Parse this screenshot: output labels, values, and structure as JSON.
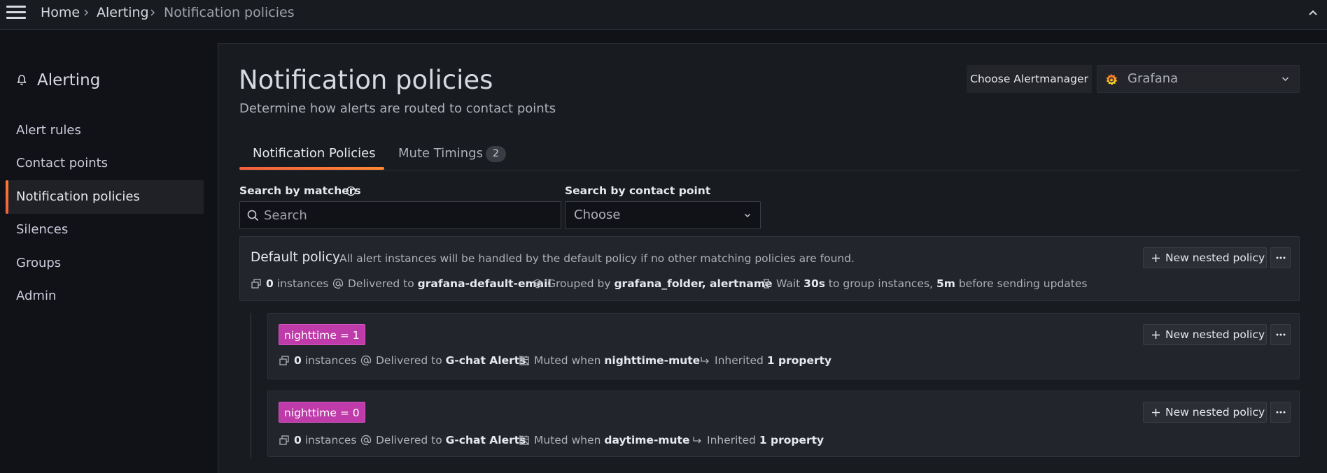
{
  "breadcrumbs": [
    {
      "label": "Home"
    },
    {
      "label": "Alerting"
    },
    {
      "label": "Notification policies"
    }
  ],
  "sidebar": {
    "title": "Alerting",
    "items": [
      {
        "label": "Alert rules",
        "active": false
      },
      {
        "label": "Contact points",
        "active": false
      },
      {
        "label": "Notification policies",
        "active": true
      },
      {
        "label": "Silences",
        "active": false
      },
      {
        "label": "Groups",
        "active": false
      },
      {
        "label": "Admin",
        "active": false
      }
    ]
  },
  "page": {
    "title": "Notification policies",
    "subtitle": "Determine how alerts are routed to contact points"
  },
  "alertmanager": {
    "label": "Choose Alertmanager",
    "value": "Grafana"
  },
  "tabs": [
    {
      "label": "Notification Policies",
      "active": true
    },
    {
      "label": "Mute Timings",
      "active": false,
      "count": "2"
    }
  ],
  "filters": {
    "matchers_label": "Search by matchers",
    "search_placeholder": "Search",
    "contact_label": "Search by contact point",
    "contact_value": "Choose"
  },
  "default_policy": {
    "title": "Default policy",
    "description": "All alert instances will be handled by the default policy if no other matching policies are found.",
    "instances_count": "0",
    "instances_word": "instances",
    "delivered_prefix": "Delivered to",
    "contact_point": "grafana-default-email",
    "grouped_prefix": "Grouped by",
    "grouped_by": "grafana_folder, alertname",
    "wait_prefix": "Wait",
    "wait_value": "30s",
    "wait_middle": "to group instances,",
    "repeat_value": "5m",
    "repeat_suffix": "before sending updates",
    "new_button": "New nested policy"
  },
  "policies": [
    {
      "matcher": "nighttime = 1",
      "instances_count": "0",
      "instances_word": "instances",
      "delivered_prefix": "Delivered to",
      "contact_point": "G-chat Alerts",
      "muted_prefix": "Muted when",
      "muted_value": "nighttime-mute",
      "inherited_prefix": "Inherited",
      "inherited_value": "1 property",
      "new_button": "New nested policy"
    },
    {
      "matcher": "nighttime = 0",
      "instances_count": "0",
      "instances_word": "instances",
      "delivered_prefix": "Delivered to",
      "contact_point": "G-chat Alerts",
      "muted_prefix": "Muted when",
      "muted_value": "daytime-mute",
      "inherited_prefix": "Inherited",
      "inherited_value": "1 property",
      "new_button": "New nested policy"
    }
  ],
  "colors": {
    "accent": "#f55f3e",
    "matcher_bg": "#bf3ba9",
    "background": "#111217",
    "panel": "#181b1f"
  },
  "icons": [
    "menu-icon",
    "chevron-right-icon",
    "chevron-up-icon",
    "bell-icon",
    "grafana-logo-icon",
    "chevron-down-icon",
    "info-icon",
    "search-icon",
    "plus-icon",
    "ellipsis-icon",
    "layers-icon",
    "at-icon",
    "stack-icon",
    "hourglass-icon",
    "calendar-slash-icon",
    "arrow-return-icon"
  ]
}
